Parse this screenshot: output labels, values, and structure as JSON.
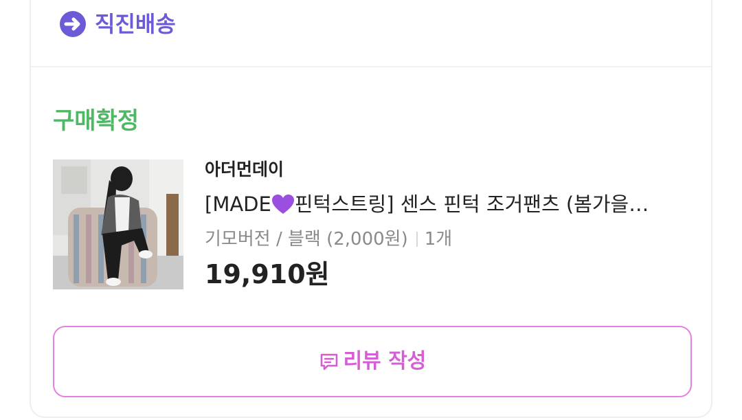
{
  "shipping": {
    "icon": "arrow-right-circle-icon",
    "label": "직진배송",
    "color": "#6b5bd6"
  },
  "order": {
    "status": "구매확정",
    "status_color": "#4fb865"
  },
  "product": {
    "image": "product-photo",
    "brand": "아더먼데이",
    "title_prefix": "[MADE",
    "title_icon": "purple-heart-icon",
    "title_rest": "핀턱스트링] 센스 핀턱 조거팬츠 (봄가을…",
    "option": "기모버전 / 블랙  (2,000원)",
    "quantity": "1개",
    "price": "19,910원"
  },
  "review_button": {
    "icon": "review-speech-icon",
    "label": "리뷰 작성",
    "color": "#d65ed4"
  }
}
